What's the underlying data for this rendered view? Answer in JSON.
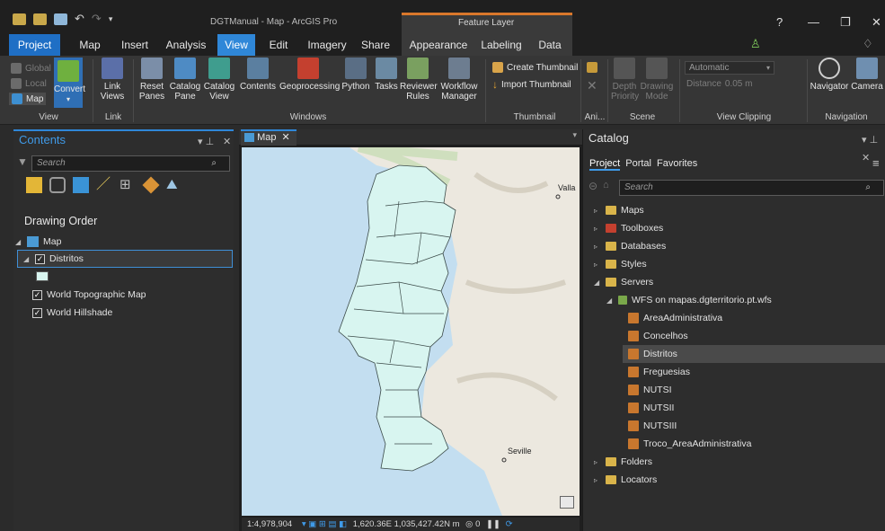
{
  "window": {
    "title": "DGTManual - Map - ArcGIS Pro",
    "context_label": "Feature Layer",
    "help": "?",
    "minimize": "—",
    "restore": "❐",
    "close": "✕"
  },
  "tabs": [
    "Project",
    "Map",
    "Insert",
    "Analysis",
    "View",
    "Edit",
    "Imagery",
    "Share",
    "Appearance",
    "Labeling",
    "Data"
  ],
  "ribbon": {
    "view_group": {
      "global": "Global",
      "local": "Local",
      "map": "Map",
      "convert": "Convert",
      "label": "View"
    },
    "link_group": {
      "link_views": "Link\nViews",
      "label": "Link"
    },
    "windows_group": {
      "reset_panes": "Reset\nPanes",
      "catalog_pane": "Catalog\nPane",
      "catalog_view": "Catalog\nView",
      "contents": "Contents",
      "geoprocessing": "Geoprocessing",
      "python": "Python",
      "tasks": "Tasks",
      "reviewer_rules": "Reviewer\nRules",
      "workflow_manager": "Workflow\nManager",
      "label": "Windows"
    },
    "thumbnail_group": {
      "create": "Create Thumbnail",
      "import": "Import Thumbnail",
      "label": "Thumbnail"
    },
    "animation_group": {
      "label": "Ani..."
    },
    "scene_group": {
      "depth_priority": "Depth\nPriority",
      "drawing_mode": "Drawing\nMode",
      "label": "Scene"
    },
    "clipping_group": {
      "mode": "Automatic",
      "distance_label": "Distance",
      "distance_value": "0.05 m",
      "label": "View Clipping"
    },
    "navigation_group": {
      "navigator": "Navigator",
      "camera": "Camera",
      "label": "Navigation"
    }
  },
  "contents": {
    "title": "Contents",
    "search_placeholder": "Search",
    "drawing_order": "Drawing Order",
    "layers": {
      "map": "Map",
      "distritos": "Distritos",
      "topo": "World Topographic Map",
      "hillshade": "World Hillshade"
    }
  },
  "map": {
    "tab_label": "Map",
    "labels": {
      "valladolid": "Valla",
      "seville": "Seville"
    },
    "scale": "1:4,978,904",
    "coords": "1,620.36E 1,035,427.42N m",
    "status_count": "0"
  },
  "catalog": {
    "title": "Catalog",
    "tabs": [
      "Project",
      "Portal",
      "Favorites"
    ],
    "search_placeholder": "Search",
    "items": {
      "maps": "Maps",
      "toolboxes": "Toolboxes",
      "databases": "Databases",
      "styles": "Styles",
      "servers": "Servers",
      "wfs": "WFS on mapas.dgterritorio.pt.wfs",
      "layers": [
        "AreaAdministrativa",
        "Concelhos",
        "Distritos",
        "Freguesias",
        "NUTSI",
        "NUTSII",
        "NUTSIII",
        "Troco_AreaAdministrativa"
      ],
      "folders": "Folders",
      "locators": "Locators"
    }
  },
  "colors": {
    "accent": "#2f87d8",
    "project_tab": "#1f6fc5",
    "context_orange": "#d9772b",
    "selection": "#4a4a4a",
    "polygon_fill": "#d8f5f0"
  }
}
